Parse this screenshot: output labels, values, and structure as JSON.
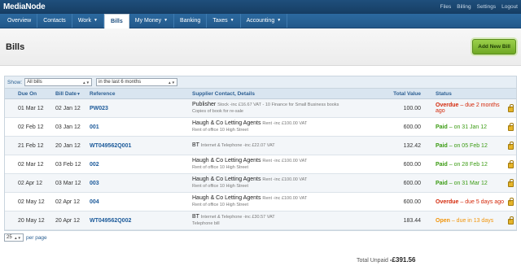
{
  "app": {
    "title": "MediaNode"
  },
  "top_links": [
    "Files",
    "Billing",
    "Settings",
    "Logout"
  ],
  "nav": [
    {
      "label": "Overview",
      "dropdown": false,
      "active": false
    },
    {
      "label": "Contacts",
      "dropdown": false,
      "active": false
    },
    {
      "label": "Work",
      "dropdown": true,
      "active": false
    },
    {
      "label": "Bills",
      "dropdown": false,
      "active": true
    },
    {
      "label": "My Money",
      "dropdown": true,
      "active": false
    },
    {
      "label": "Banking",
      "dropdown": false,
      "active": false
    },
    {
      "label": "Taxes",
      "dropdown": true,
      "active": false
    },
    {
      "label": "Accounting",
      "dropdown": true,
      "active": false
    }
  ],
  "page": {
    "title": "Bills",
    "add_button": "Add New Bill"
  },
  "filter": {
    "label": "Show:",
    "type_value": "All bills",
    "period_value": "in the last 6 months"
  },
  "columns": {
    "due_on": "Due On",
    "bill_date": "Bill Date",
    "reference": "Reference",
    "supplier": "Supplier Contact, Details",
    "total": "Total Value",
    "status": "Status"
  },
  "rows": [
    {
      "due_on": "01 Mar 12",
      "bill_date": "02 Jan 12",
      "reference": "PW023",
      "supplier": "Publisher",
      "detail": "Stock -inc £16.67 VAT - 10 Finance for Small Business books",
      "note": "Copies of book for re-sale",
      "total": "100.00",
      "status": "Overdue",
      "status_rest": " – due 2 months ago",
      "status_type": "red"
    },
    {
      "due_on": "02 Feb 12",
      "bill_date": "03 Jan 12",
      "reference": "001",
      "supplier": "Haugh & Co Letting Agents",
      "detail": "Rent -inc £100.00 VAT",
      "note": "Rent of office 10 High Street",
      "total": "600.00",
      "status": "Paid",
      "status_rest": " – on 31 Jan 12",
      "status_type": "green"
    },
    {
      "due_on": "21 Feb 12",
      "bill_date": "20 Jan 12",
      "reference": "WT049562Q001",
      "supplier": "BT",
      "detail": "Internet & Telephone -inc £22.07 VAT",
      "note": "",
      "total": "132.42",
      "status": "Paid",
      "status_rest": " – on 05 Feb 12",
      "status_type": "green"
    },
    {
      "due_on": "02 Mar 12",
      "bill_date": "03 Feb 12",
      "reference": "002",
      "supplier": "Haugh & Co Letting Agents",
      "detail": "Rent -inc £100.00 VAT",
      "note": "Rent of office 10 High Street",
      "total": "600.00",
      "status": "Paid",
      "status_rest": " – on 28 Feb 12",
      "status_type": "green"
    },
    {
      "due_on": "02 Apr 12",
      "bill_date": "03 Mar 12",
      "reference": "003",
      "supplier": "Haugh & Co Letting Agents",
      "detail": "Rent -inc £100.00 VAT",
      "note": "Rent of office 10 High Street",
      "total": "600.00",
      "status": "Paid",
      "status_rest": " – on 31 Mar 12",
      "status_type": "green"
    },
    {
      "due_on": "02 May 12",
      "bill_date": "02 Apr 12",
      "reference": "004",
      "supplier": "Haugh & Co Letting Agents",
      "detail": "Rent -inc £100.00 VAT",
      "note": "Rent of office 10 High Street",
      "total": "600.00",
      "status": "Overdue",
      "status_rest": " – due 5 days ago",
      "status_type": "red"
    },
    {
      "due_on": "20 May 12",
      "bill_date": "20 Apr 12",
      "reference": "WT049562Q002",
      "supplier": "BT",
      "detail": "Internet & Telephone -inc £30.57 VAT",
      "note": "Telephone bill",
      "total": "183.44",
      "status": "Open",
      "status_rest": " – due in 13 days",
      "status_type": "orange"
    }
  ],
  "pager": {
    "value": "25",
    "label": "per page"
  },
  "summary": {
    "label": "Total Unpaid",
    "value": "-£391.56"
  }
}
